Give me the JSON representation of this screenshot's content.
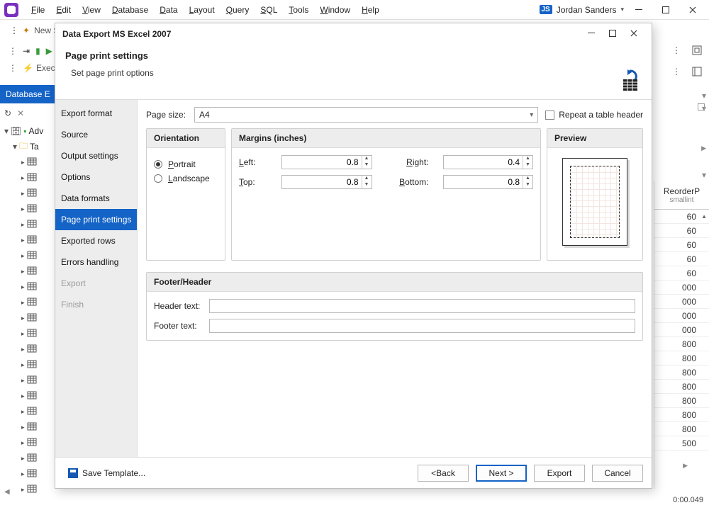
{
  "menu": {
    "items": [
      "File",
      "Edit",
      "View",
      "Database",
      "Data",
      "Layout",
      "Query",
      "SQL",
      "Tools",
      "Window",
      "Help"
    ],
    "user_initials": "JS",
    "user_name": "Jordan Sanders"
  },
  "toolbar": {
    "new_tab": "New S",
    "execute": "Execu"
  },
  "explorer": {
    "title": "Database E",
    "root": "Adv",
    "tables_node": "Ta"
  },
  "grid": {
    "col_name": "ReorderP",
    "col_type": "smallint",
    "values": [
      "60",
      "60",
      "60",
      "60",
      "60",
      "000",
      "000",
      "000",
      "000",
      "800",
      "800",
      "800",
      "800",
      "800",
      "800",
      "800",
      "500"
    ]
  },
  "status": {
    "elapsed": "0:00.049"
  },
  "dialog": {
    "title": "Data Export MS Excel 2007",
    "heading": "Page print settings",
    "subheading": "Set page print options",
    "nav": [
      "Export format",
      "Source",
      "Output settings",
      "Options",
      "Data formats",
      "Page print settings",
      "Exported rows",
      "Errors handling",
      "Export",
      "Finish"
    ],
    "nav_selected_index": 5,
    "nav_disabled": [
      8,
      9
    ],
    "page_size_label": "Page size:",
    "page_size_value": "A4",
    "repeat_header": "Repeat a table header",
    "orientation": {
      "title": "Orientation",
      "portrait": "Portrait",
      "landscape": "Landscape",
      "value": "portrait"
    },
    "margins": {
      "title": "Margins (inches)",
      "left_label": "Left:",
      "left": "0.8",
      "right_label": "Right:",
      "right": "0.4",
      "top_label": "Top:",
      "top": "0.8",
      "bottom_label": "Bottom:",
      "bottom": "0.8"
    },
    "preview_title": "Preview",
    "footerheader": {
      "title": "Footer/Header",
      "header_label": "Header text:",
      "footer_label": "Footer text:",
      "header": "",
      "footer": ""
    },
    "buttons": {
      "save_template": "Save Template...",
      "back": "< Back",
      "next": "Next >",
      "export": "Export",
      "cancel": "Cancel"
    }
  }
}
